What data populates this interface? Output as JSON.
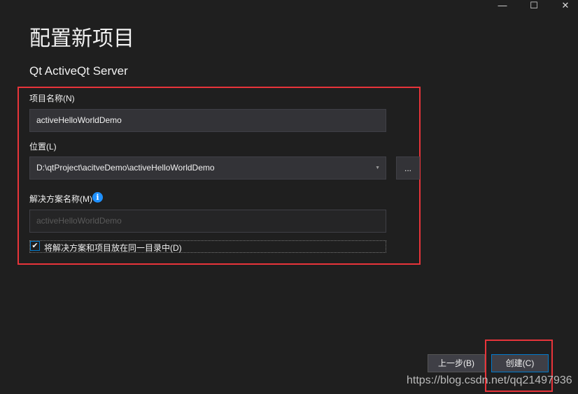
{
  "window_controls": {
    "minimize": "—",
    "maximize": "☐",
    "close": "✕"
  },
  "title": "配置新项目",
  "subtitle": "Qt ActiveQt Server",
  "project_name": {
    "label": "项目名称(N)",
    "value": "activeHelloWorldDemo"
  },
  "location": {
    "label": "位置(L)",
    "value": "D:\\qtProject\\acitveDemo\\activeHelloWorldDemo",
    "browse": "..."
  },
  "solution_name": {
    "label": "解决方案名称(M)",
    "placeholder": "activeHelloWorldDemo"
  },
  "same_dir": {
    "label": "将解决方案和项目放在同一目录中(D)",
    "checked": true
  },
  "buttons": {
    "back": "上一步(B)",
    "create": "创建(C)"
  },
  "watermark": "https://blog.csdn.net/qq21497936",
  "colors": {
    "highlight": "#e8343a",
    "accent": "#007acc",
    "info": "#1e90ff"
  }
}
